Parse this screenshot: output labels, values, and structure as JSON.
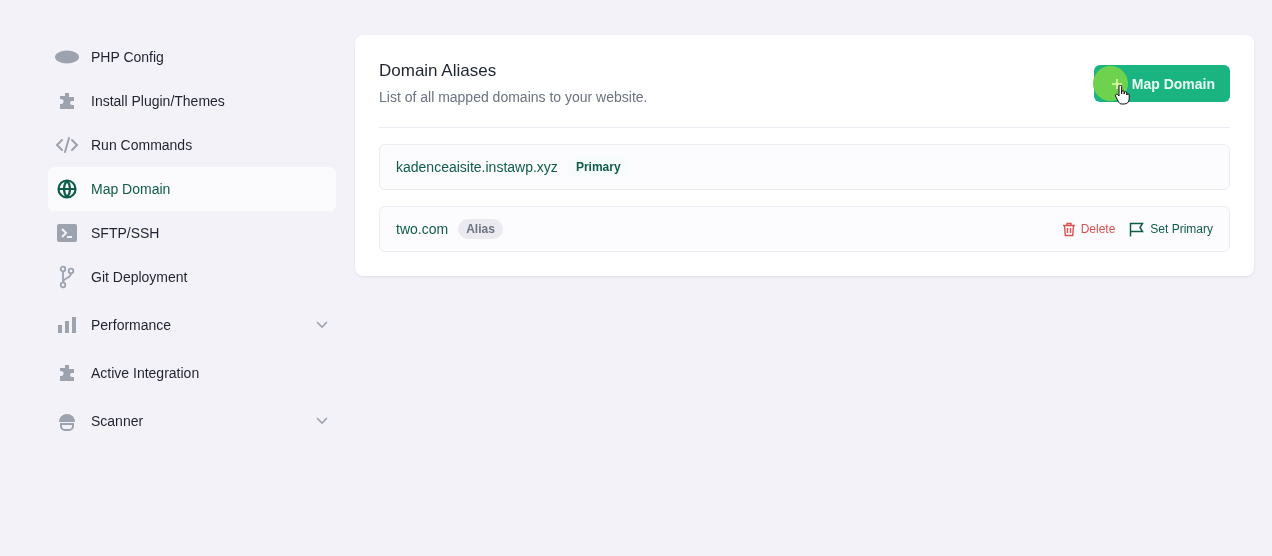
{
  "sidebar": {
    "items": [
      {
        "label": "PHP Config",
        "kind": "link",
        "selected": false
      },
      {
        "label": "Install Plugin/Themes",
        "kind": "link",
        "selected": false
      },
      {
        "label": "Run Commands",
        "kind": "link",
        "selected": false
      },
      {
        "label": "Map Domain",
        "kind": "link",
        "selected": true
      },
      {
        "label": "SFTP/SSH",
        "kind": "link",
        "selected": false
      },
      {
        "label": "Git Deployment",
        "kind": "link",
        "selected": false
      },
      {
        "label": "Performance",
        "kind": "group",
        "selected": false,
        "expanded": false
      },
      {
        "label": "Active Integration",
        "kind": "link",
        "selected": false
      },
      {
        "label": "Scanner",
        "kind": "group",
        "selected": false,
        "expanded": false
      }
    ]
  },
  "panel": {
    "title": "Domain Aliases",
    "subtitle": "List of all mapped domains to your website.",
    "add_button": "Map Domain",
    "domains": [
      {
        "name": "kadenceaisite.instawp.xyz",
        "kind": "primary",
        "badge": "Primary"
      },
      {
        "name": "two.com",
        "kind": "alias",
        "badge": "Alias",
        "actions": [
          "Delete",
          "Set Primary"
        ]
      }
    ]
  }
}
